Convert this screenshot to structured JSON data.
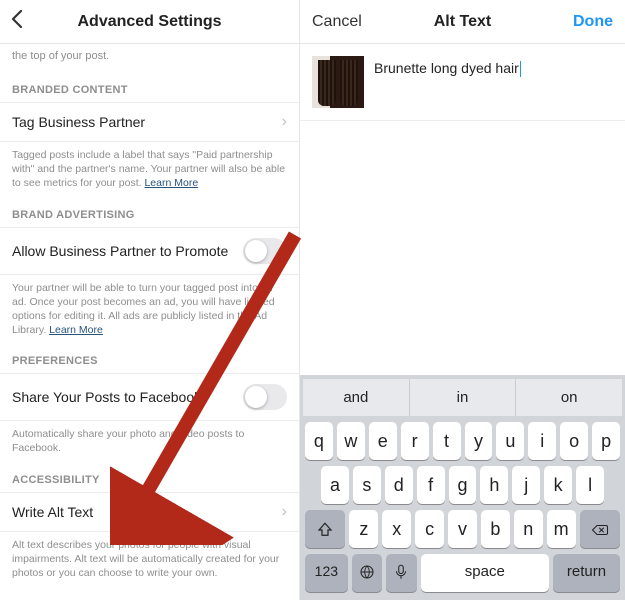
{
  "left": {
    "header_title": "Advanced Settings",
    "top_desc": "the top of your post.",
    "branded_header": "BRANDED CONTENT",
    "tag_partner": "Tag Business Partner",
    "tag_desc": "Tagged posts include a label that says \"Paid partnership with\" and the partner's name. Your partner will also be able to see metrics for your post. ",
    "learn_more": "Learn More",
    "brand_adv_header": "BRAND ADVERTISING",
    "allow_promote": "Allow Business Partner to Promote",
    "allow_desc": "Your partner will be able to turn your tagged post into an ad. Once your post becomes an ad, you will have limited options for editing it. All ads are publicly listed in the Ad Library. ",
    "prefs_header": "PREFERENCES",
    "share_fb": "Share Your Posts to Facebook",
    "share_desc": "Automatically share your photo and video posts to Facebook.",
    "access_header": "ACCESSIBILITY",
    "write_alt": "Write Alt Text",
    "alt_desc": "Alt text describes your photos for people with visual impairments. Alt text will be automatically created for your photos or you can choose to write your own."
  },
  "right": {
    "cancel": "Cancel",
    "title": "Alt Text",
    "done": "Done",
    "alt_value": "Brunette long dyed hair",
    "suggestions": [
      "and",
      "in",
      "on"
    ],
    "rows": {
      "r1": [
        "q",
        "w",
        "e",
        "r",
        "t",
        "y",
        "u",
        "i",
        "o",
        "p"
      ],
      "r2": [
        "a",
        "s",
        "d",
        "f",
        "g",
        "h",
        "j",
        "k",
        "l"
      ],
      "r3": [
        "z",
        "x",
        "c",
        "v",
        "b",
        "n",
        "m"
      ]
    },
    "num_key": "123",
    "space": "space",
    "return": "return"
  }
}
